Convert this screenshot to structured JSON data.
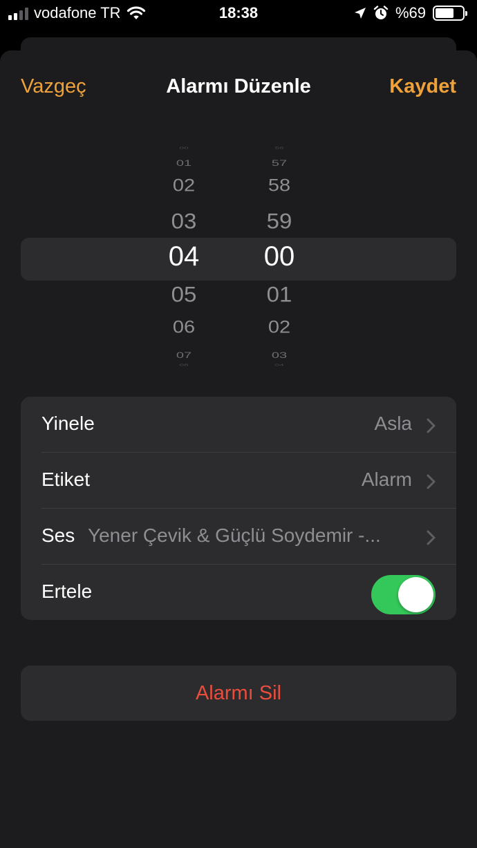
{
  "status_bar": {
    "carrier": "vodafone TR",
    "time": "18:38",
    "battery": "%69",
    "battery_level": 0.69,
    "icons": [
      "signal-icon",
      "wifi-icon",
      "location-icon",
      "alarm-clock-icon",
      "battery-icon"
    ]
  },
  "nav": {
    "cancel_label": "Vazgeç",
    "title": "Alarmı Düzenle",
    "save_label": "Kaydet"
  },
  "picker": {
    "hours": [
      "00",
      "01",
      "02",
      "03",
      "04",
      "05",
      "06",
      "07",
      "08"
    ],
    "minutes": [
      "56",
      "57",
      "58",
      "59",
      "00",
      "01",
      "02",
      "03",
      "04"
    ],
    "selected_hour": "04",
    "selected_minute": "00"
  },
  "settings": {
    "repeat": {
      "label": "Yinele",
      "value": "Asla"
    },
    "label": {
      "label": "Etiket",
      "value": "Alarm"
    },
    "sound": {
      "label": "Ses",
      "value": "Yener Çevik & Güçlü Soydemir -..."
    },
    "snooze": {
      "label": "Ertele",
      "enabled": true
    }
  },
  "delete_label": "Alarmı Sil",
  "colors": {
    "accent": "#f0a23a",
    "destructive": "#eb4d3d",
    "toggle_on": "#34c759",
    "background": "#1c1c1e",
    "cell": "#2c2c2e"
  }
}
